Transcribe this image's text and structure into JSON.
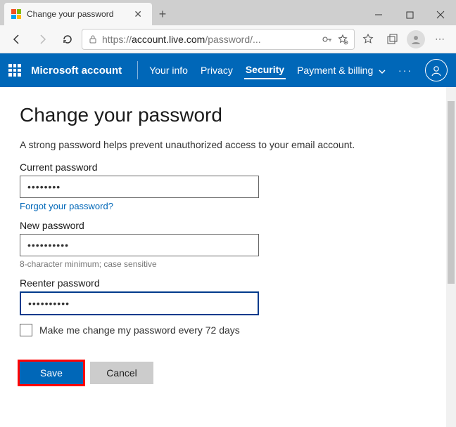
{
  "browser": {
    "tab_title": "Change your password",
    "url_prefix": "https://",
    "url_host": "account.live.com",
    "url_path": "/password/..."
  },
  "nav": {
    "brand": "Microsoft account",
    "your_info": "Your info",
    "privacy": "Privacy",
    "security": "Security",
    "payment": "Payment & billing"
  },
  "page": {
    "heading": "Change your password",
    "description": "A strong password helps prevent unauthorized access to your email account.",
    "current_label": "Current password",
    "current_value": "••••••••",
    "forgot_link": "Forgot your password?",
    "new_label": "New password",
    "new_value": "••••••••••",
    "hint": "8-character minimum; case sensitive",
    "reenter_label": "Reenter password",
    "reenter_value": "••••••••••",
    "checkbox_label": "Make me change my password every 72 days",
    "save": "Save",
    "cancel": "Cancel"
  }
}
